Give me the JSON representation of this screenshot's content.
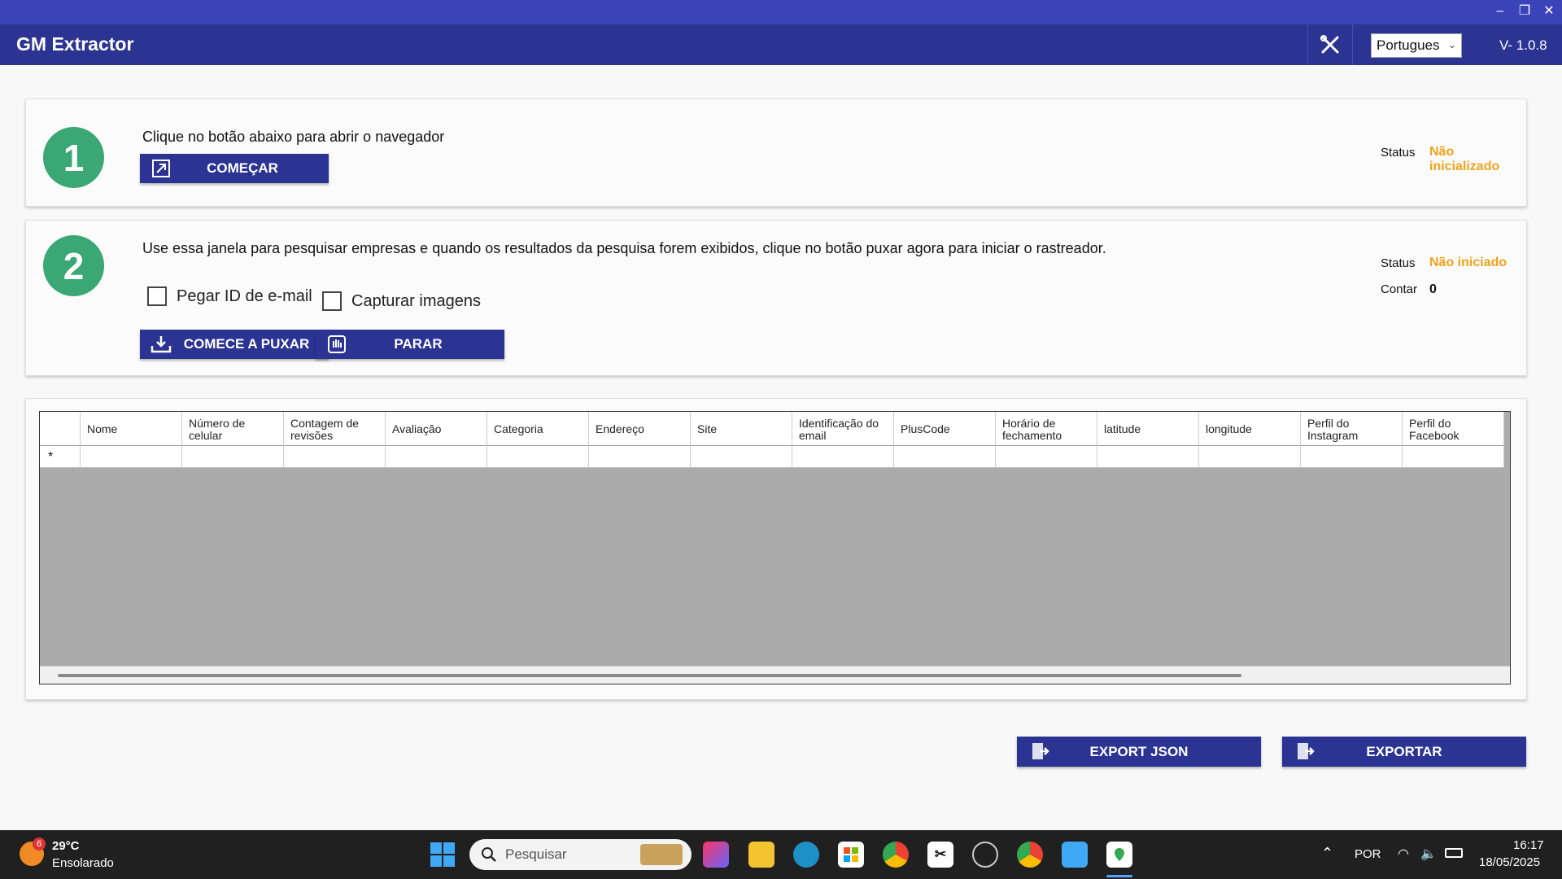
{
  "app": {
    "title": "GM Extractor",
    "version": "V- 1.0.8",
    "language": "Portugues"
  },
  "window_controls": {
    "minimize": "–",
    "maximize": "❐",
    "close": "✕"
  },
  "step1": {
    "number": "1",
    "description": "Clique no botão abaixo para abrir o navegador",
    "start_button": "COMEÇAR",
    "status_label": "Status",
    "status_value": "Não inicializado"
  },
  "step2": {
    "number": "2",
    "description": "Use essa janela para pesquisar empresas e quando os resultados da pesquisa forem exibidos, clique no botão puxar agora para iniciar o rastreador.",
    "checkbox_email": "Pegar ID de e-mail",
    "checkbox_images": "Capturar imagens",
    "pull_button": "COMECE A PUXAR",
    "stop_button": "PARAR",
    "status_label": "Status",
    "status_value": "Não iniciado",
    "count_label": "Contar",
    "count_value": "0"
  },
  "grid": {
    "columns": [
      "Nome",
      "Número de celular",
      "Contagem de revisões",
      "Avaliação",
      "Categoria",
      "Endereço",
      "Site",
      "Identificação do email",
      "PlusCode",
      "Horário de fechamento",
      "latitude",
      "longitude",
      "Perfil do Instagram",
      "Perfil do Facebook"
    ],
    "new_row_marker": "*"
  },
  "export": {
    "json_button": "EXPORT JSON",
    "export_button": "EXPORTAR"
  },
  "taskbar": {
    "weather_temp": "29°C",
    "weather_desc": "Ensolarado",
    "weather_badge": "6",
    "search_placeholder": "Pesquisar",
    "language": "POR",
    "time": "16:17",
    "date": "18/05/2025"
  },
  "colors": {
    "header": "#2c3493",
    "accent_green": "#3aa774",
    "status_orange": "#f2a21a"
  }
}
